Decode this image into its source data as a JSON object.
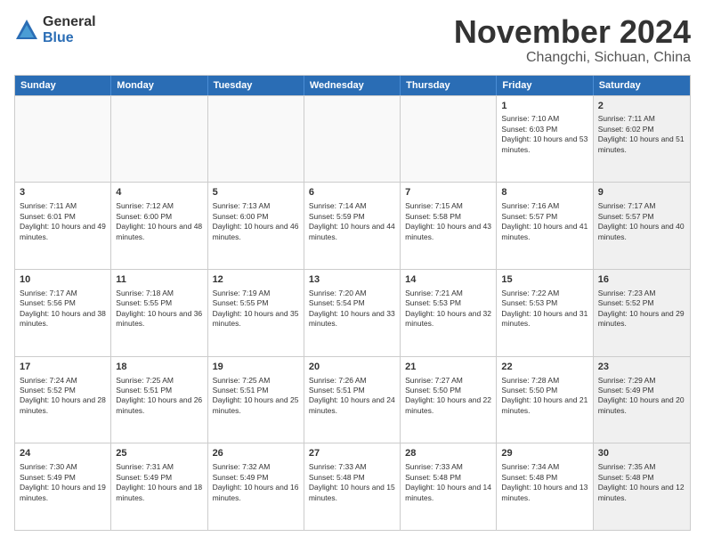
{
  "header": {
    "logo_general": "General",
    "logo_blue": "Blue",
    "month_title": "November 2024",
    "location": "Changchi, Sichuan, China"
  },
  "calendar": {
    "days_of_week": [
      "Sunday",
      "Monday",
      "Tuesday",
      "Wednesday",
      "Thursday",
      "Friday",
      "Saturday"
    ],
    "weeks": [
      [
        {
          "day": "",
          "info": "",
          "empty": true
        },
        {
          "day": "",
          "info": "",
          "empty": true
        },
        {
          "day": "",
          "info": "",
          "empty": true
        },
        {
          "day": "",
          "info": "",
          "empty": true
        },
        {
          "day": "",
          "info": "",
          "empty": true
        },
        {
          "day": "1",
          "info": "Sunrise: 7:10 AM\nSunset: 6:03 PM\nDaylight: 10 hours and 53 minutes.",
          "empty": false
        },
        {
          "day": "2",
          "info": "Sunrise: 7:11 AM\nSunset: 6:02 PM\nDaylight: 10 hours and 51 minutes.",
          "empty": false,
          "shaded": true
        }
      ],
      [
        {
          "day": "3",
          "info": "Sunrise: 7:11 AM\nSunset: 6:01 PM\nDaylight: 10 hours and 49 minutes.",
          "empty": false
        },
        {
          "day": "4",
          "info": "Sunrise: 7:12 AM\nSunset: 6:00 PM\nDaylight: 10 hours and 48 minutes.",
          "empty": false
        },
        {
          "day": "5",
          "info": "Sunrise: 7:13 AM\nSunset: 6:00 PM\nDaylight: 10 hours and 46 minutes.",
          "empty": false
        },
        {
          "day": "6",
          "info": "Sunrise: 7:14 AM\nSunset: 5:59 PM\nDaylight: 10 hours and 44 minutes.",
          "empty": false
        },
        {
          "day": "7",
          "info": "Sunrise: 7:15 AM\nSunset: 5:58 PM\nDaylight: 10 hours and 43 minutes.",
          "empty": false
        },
        {
          "day": "8",
          "info": "Sunrise: 7:16 AM\nSunset: 5:57 PM\nDaylight: 10 hours and 41 minutes.",
          "empty": false
        },
        {
          "day": "9",
          "info": "Sunrise: 7:17 AM\nSunset: 5:57 PM\nDaylight: 10 hours and 40 minutes.",
          "empty": false,
          "shaded": true
        }
      ],
      [
        {
          "day": "10",
          "info": "Sunrise: 7:17 AM\nSunset: 5:56 PM\nDaylight: 10 hours and 38 minutes.",
          "empty": false
        },
        {
          "day": "11",
          "info": "Sunrise: 7:18 AM\nSunset: 5:55 PM\nDaylight: 10 hours and 36 minutes.",
          "empty": false
        },
        {
          "day": "12",
          "info": "Sunrise: 7:19 AM\nSunset: 5:55 PM\nDaylight: 10 hours and 35 minutes.",
          "empty": false
        },
        {
          "day": "13",
          "info": "Sunrise: 7:20 AM\nSunset: 5:54 PM\nDaylight: 10 hours and 33 minutes.",
          "empty": false
        },
        {
          "day": "14",
          "info": "Sunrise: 7:21 AM\nSunset: 5:53 PM\nDaylight: 10 hours and 32 minutes.",
          "empty": false
        },
        {
          "day": "15",
          "info": "Sunrise: 7:22 AM\nSunset: 5:53 PM\nDaylight: 10 hours and 31 minutes.",
          "empty": false
        },
        {
          "day": "16",
          "info": "Sunrise: 7:23 AM\nSunset: 5:52 PM\nDaylight: 10 hours and 29 minutes.",
          "empty": false,
          "shaded": true
        }
      ],
      [
        {
          "day": "17",
          "info": "Sunrise: 7:24 AM\nSunset: 5:52 PM\nDaylight: 10 hours and 28 minutes.",
          "empty": false
        },
        {
          "day": "18",
          "info": "Sunrise: 7:25 AM\nSunset: 5:51 PM\nDaylight: 10 hours and 26 minutes.",
          "empty": false
        },
        {
          "day": "19",
          "info": "Sunrise: 7:25 AM\nSunset: 5:51 PM\nDaylight: 10 hours and 25 minutes.",
          "empty": false
        },
        {
          "day": "20",
          "info": "Sunrise: 7:26 AM\nSunset: 5:51 PM\nDaylight: 10 hours and 24 minutes.",
          "empty": false
        },
        {
          "day": "21",
          "info": "Sunrise: 7:27 AM\nSunset: 5:50 PM\nDaylight: 10 hours and 22 minutes.",
          "empty": false
        },
        {
          "day": "22",
          "info": "Sunrise: 7:28 AM\nSunset: 5:50 PM\nDaylight: 10 hours and 21 minutes.",
          "empty": false
        },
        {
          "day": "23",
          "info": "Sunrise: 7:29 AM\nSunset: 5:49 PM\nDaylight: 10 hours and 20 minutes.",
          "empty": false,
          "shaded": true
        }
      ],
      [
        {
          "day": "24",
          "info": "Sunrise: 7:30 AM\nSunset: 5:49 PM\nDaylight: 10 hours and 19 minutes.",
          "empty": false
        },
        {
          "day": "25",
          "info": "Sunrise: 7:31 AM\nSunset: 5:49 PM\nDaylight: 10 hours and 18 minutes.",
          "empty": false
        },
        {
          "day": "26",
          "info": "Sunrise: 7:32 AM\nSunset: 5:49 PM\nDaylight: 10 hours and 16 minutes.",
          "empty": false
        },
        {
          "day": "27",
          "info": "Sunrise: 7:33 AM\nSunset: 5:48 PM\nDaylight: 10 hours and 15 minutes.",
          "empty": false
        },
        {
          "day": "28",
          "info": "Sunrise: 7:33 AM\nSunset: 5:48 PM\nDaylight: 10 hours and 14 minutes.",
          "empty": false
        },
        {
          "day": "29",
          "info": "Sunrise: 7:34 AM\nSunset: 5:48 PM\nDaylight: 10 hours and 13 minutes.",
          "empty": false
        },
        {
          "day": "30",
          "info": "Sunrise: 7:35 AM\nSunset: 5:48 PM\nDaylight: 10 hours and 12 minutes.",
          "empty": false,
          "shaded": true
        }
      ]
    ]
  }
}
